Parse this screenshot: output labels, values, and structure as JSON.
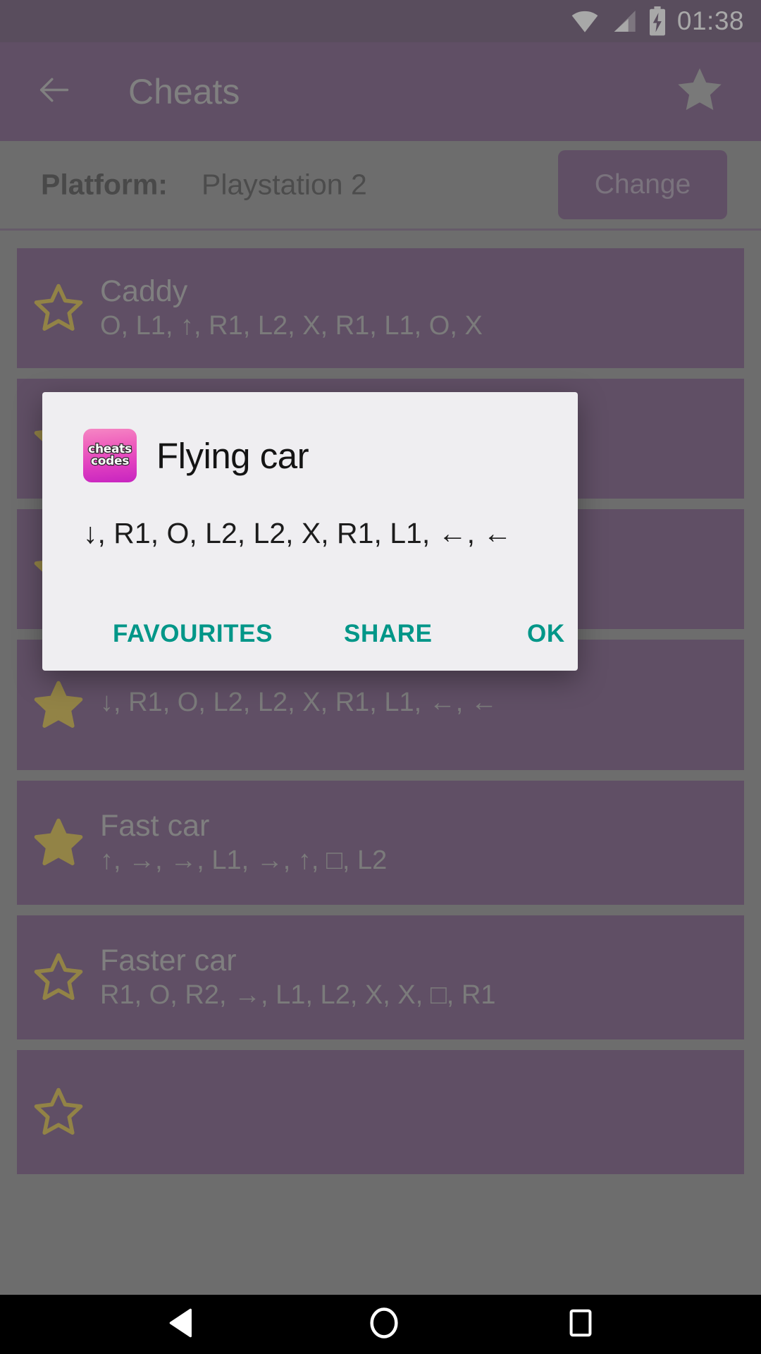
{
  "status_bar": {
    "time": "01:38",
    "icons": [
      "wifi-icon",
      "cellular-signal-icon",
      "battery-charging-icon"
    ],
    "background": "#3b1c44"
  },
  "app_bar": {
    "back_label": "back-arrow",
    "title": "Cheats",
    "favourite_label": "star",
    "background": "#4d2257",
    "title_color": "#9b9b9b"
  },
  "platform": {
    "label": "Platform:",
    "value": "Playstation 2",
    "change_label": "Change"
  },
  "cheat_list": [
    {
      "title": "Caddy",
      "code": "O, L1, ↑, R1, L2, X, R1, L1, O, X",
      "favourite": false
    },
    {
      "title": "",
      "code": "",
      "favourite": true
    },
    {
      "title": "",
      "code": "",
      "favourite": true
    },
    {
      "title": "",
      "code": "↓, R1, O, L2, L2, X, R1, L1, ←, ←",
      "favourite": true
    },
    {
      "title": "Fast car",
      "code": "↑, →, →, L1, →, ↑, □, L2",
      "favourite": true
    },
    {
      "title": "Faster car",
      "code": "R1, O, R2, →, L1, L2, X, X, □, R1",
      "favourite": false
    },
    {
      "title": "",
      "code": "",
      "favourite": false
    }
  ],
  "dialog": {
    "icon_text_line1": "cheats",
    "icon_text_line2": "codes",
    "title": "Flying car",
    "body": "↓, R1, O, L2, L2, X, R1, L1,  ←,  ←",
    "buttons": {
      "favourites": "FAVOURITES",
      "share": "SHARE",
      "ok": "OK"
    },
    "accent_color": "#009688",
    "background": "#efeef1"
  },
  "nav_bar": {
    "back": "back-triangle",
    "home": "home-circle",
    "recents": "recents-square",
    "background": "#000000"
  },
  "colors": {
    "primary_dark": "#3b1c44",
    "primary": "#4d2257",
    "card": "#4d2257",
    "star_gold": "#c9a20a",
    "scrim": "#6e6e6e",
    "accent": "#009688"
  }
}
